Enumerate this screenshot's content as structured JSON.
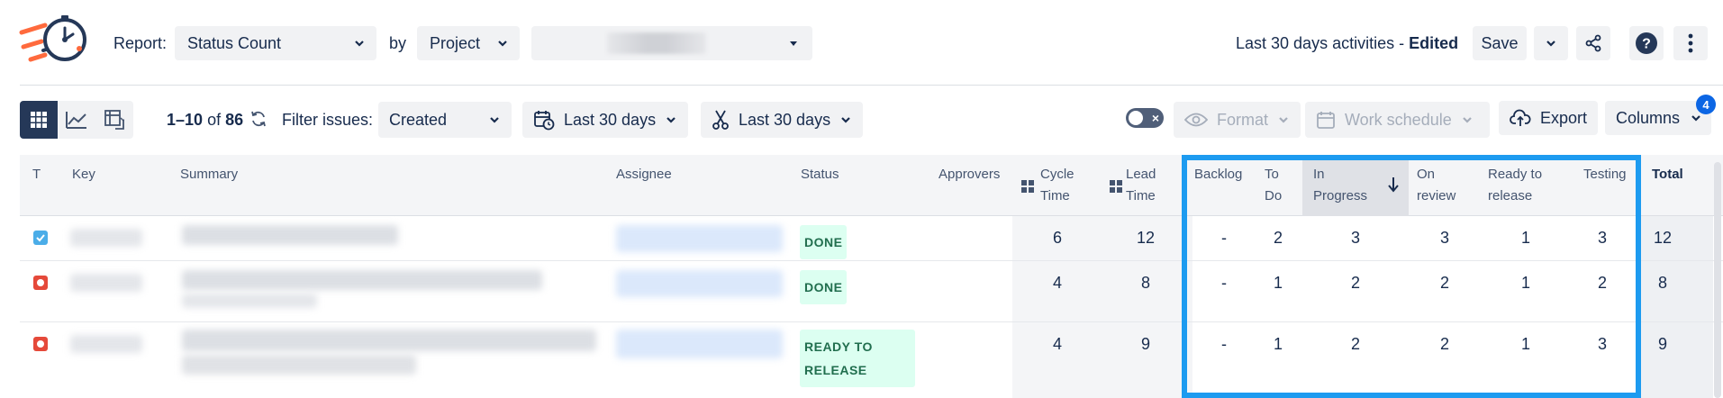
{
  "header": {
    "report_label": "Report:",
    "report_value": "Status Count",
    "by_label": "by",
    "group_value": "Project",
    "period_text": "Last 30 days activities - ",
    "edited_text": "Edited",
    "save_label": "Save"
  },
  "toolbar": {
    "range_start": "1",
    "range_end": "10",
    "of_text": "of",
    "total_count": "86",
    "filter_label": "Filter issues:",
    "filter_value": "Created",
    "date_range_1": "Last 30 days",
    "date_range_2": "Last 30 days",
    "format_label": "Format",
    "work_schedule_label": "Work schedule",
    "export_label": "Export",
    "columns_label": "Columns",
    "columns_badge": "4"
  },
  "table": {
    "headers": {
      "type": "T",
      "key": "Key",
      "summary": "Summary",
      "assignee": "Assignee",
      "status": "Status",
      "approvers": "Approvers",
      "cycle_time_1": "Cycle",
      "cycle_time_2": "Time",
      "lead_time_1": "Lead",
      "lead_time_2": "Time",
      "backlog": "Backlog",
      "todo_1": "To",
      "todo_2": "Do",
      "inprogress_1": "In",
      "inprogress_2": "Progress",
      "onreview_1": "On",
      "onreview_2": "review",
      "ready_1": "Ready to",
      "ready_2": "release",
      "testing": "Testing",
      "total": "Total"
    },
    "rows": [
      {
        "type": "task",
        "status": "DONE",
        "cycle": "6",
        "lead": "12",
        "backlog": "-",
        "todo": "2",
        "inprogress": "3",
        "onreview": "3",
        "ready": "1",
        "testing": "3",
        "total": "12"
      },
      {
        "type": "bug",
        "status": "DONE",
        "cycle": "4",
        "lead": "8",
        "backlog": "-",
        "todo": "1",
        "inprogress": "2",
        "onreview": "2",
        "ready": "1",
        "testing": "2",
        "total": "8"
      },
      {
        "type": "bug",
        "status_1": "READY TO",
        "status_2": "RELEASE",
        "cycle": "4",
        "lead": "9",
        "backlog": "-",
        "todo": "1",
        "inprogress": "2",
        "onreview": "2",
        "ready": "1",
        "testing": "3",
        "total": "9"
      }
    ]
  },
  "colors": {
    "highlight": "#1d9bf0",
    "task_icon": "#4bade8",
    "bug_icon": "#e5493a",
    "status_green_bg": "#dcfff1",
    "status_green_text": "#216e4e",
    "active_view": "#253858"
  },
  "icons": [
    "timer-logo-icon",
    "chevron-down-icon",
    "share-icon",
    "help-icon",
    "more-vertical-icon",
    "table-view-icon",
    "chart-view-icon",
    "pivot-view-icon",
    "refresh-icon",
    "calendar-icon",
    "scissors-icon",
    "eye-icon",
    "calendar-icon",
    "cloud-upload-icon",
    "sort-down-icon",
    "drag-handle-icon"
  ]
}
